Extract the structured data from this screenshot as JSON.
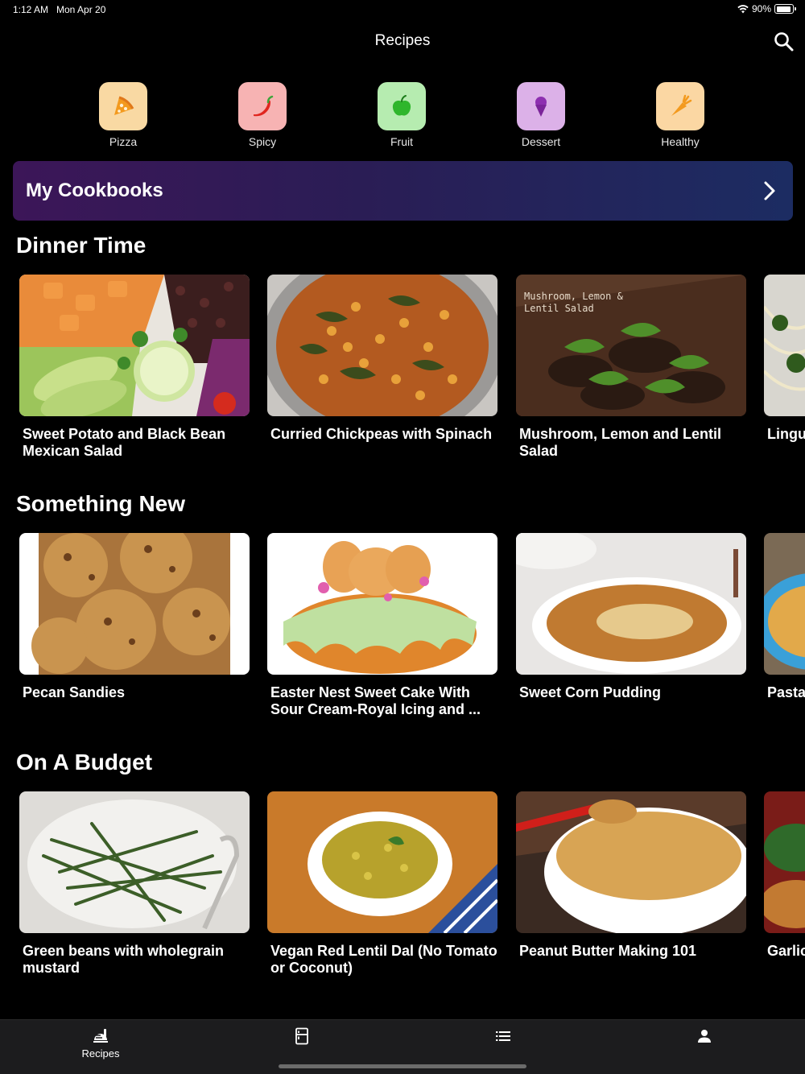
{
  "status": {
    "time": "1:12 AM",
    "date": "Mon Apr 20",
    "battery": "90%",
    "battery_level": 0.9
  },
  "header": {
    "title": "Recipes"
  },
  "categories": [
    {
      "label": "Pizza",
      "icon": "pizza-icon",
      "color": "#f9d9a3"
    },
    {
      "label": "Spicy",
      "icon": "chili-icon",
      "color": "#f7b3b3"
    },
    {
      "label": "Fruit",
      "icon": "apple-icon",
      "color": "#b6ecb0"
    },
    {
      "label": "Dessert",
      "icon": "ice-cream-icon",
      "color": "#dcb1e8"
    },
    {
      "label": "Healthy",
      "icon": "carrot-icon",
      "color": "#fbd7a3"
    }
  ],
  "cookbooks": {
    "label": "My Cookbooks"
  },
  "sections": [
    {
      "title": "Dinner Time",
      "cards": [
        {
          "title": "Sweet Potato and Black Bean Mexican Salad"
        },
        {
          "title": "Curried Chickpeas with Spinach"
        },
        {
          "title": "Mushroom, Lemon and Lentil Salad",
          "image_text": [
            "Mushroom, Lemon &",
            "Lentil Salad"
          ]
        },
        {
          "title": "Lingu White"
        }
      ]
    },
    {
      "title": "Something New",
      "cards": [
        {
          "title": "Pecan Sandies"
        },
        {
          "title": "Easter Nest Sweet Cake With Sour Cream-Royal Icing and ..."
        },
        {
          "title": "Sweet Corn Pudding"
        },
        {
          "title": "Pasta Lemo"
        }
      ]
    },
    {
      "title": "On A Budget",
      "cards": [
        {
          "title": "Green beans with wholegrain mustard"
        },
        {
          "title": "Vegan Red Lentil Dal (No Tomato or Coconut)"
        },
        {
          "title": "Peanut Butter Making 101"
        },
        {
          "title": "Garlic"
        }
      ]
    }
  ],
  "tabs": [
    {
      "label": "Recipes",
      "icon": "recipes-icon",
      "active": true
    },
    {
      "label": "",
      "icon": "fridge-icon"
    },
    {
      "label": "",
      "icon": "list-icon"
    },
    {
      "label": "",
      "icon": "profile-icon"
    }
  ]
}
